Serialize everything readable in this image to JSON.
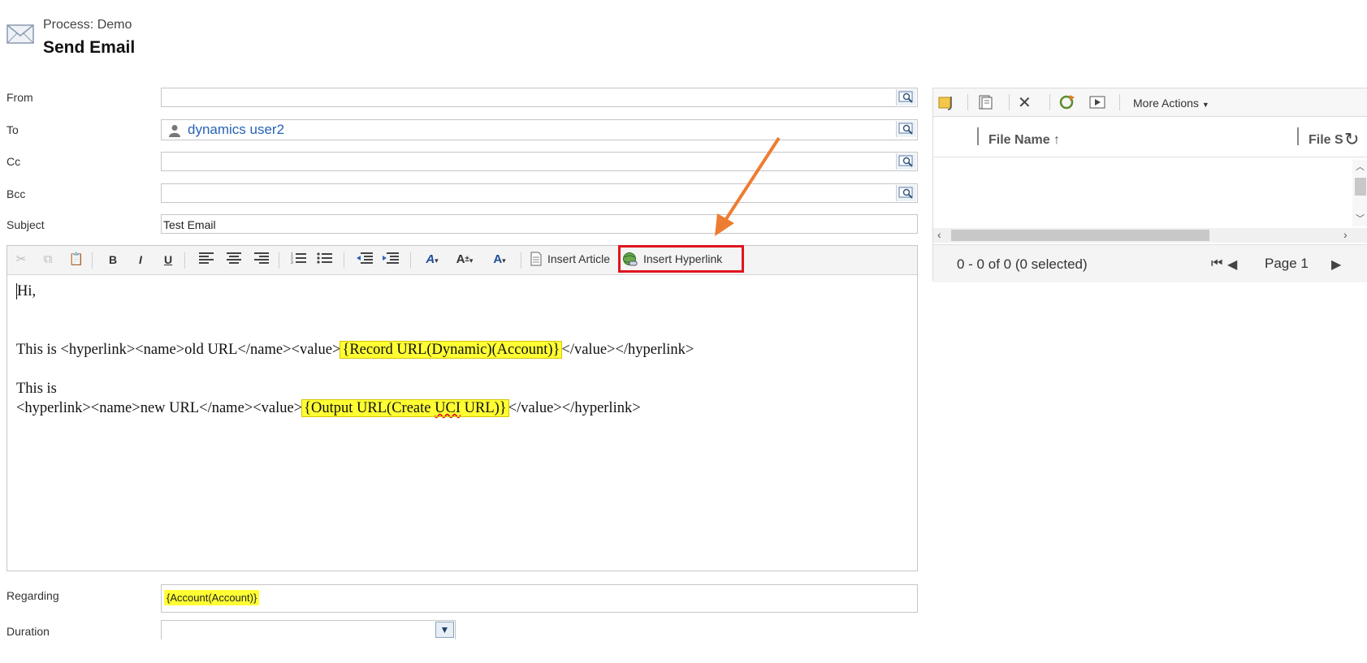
{
  "header": {
    "process_label": "Process: Demo",
    "title": "Send Email"
  },
  "form": {
    "from_label": "From",
    "to_label": "To",
    "to_value": "dynamics user2",
    "cc_label": "Cc",
    "bcc_label": "Bcc",
    "subject_label": "Subject",
    "subject_value": "Test Email",
    "regarding_label": "Regarding",
    "regarding_value": "{Account(Account)}",
    "duration_label": "Duration"
  },
  "editor": {
    "insert_article": "Insert Article",
    "insert_hyperlink": "Insert Hyperlink",
    "line1": "Hi,",
    "line2_prefix": "This is  <hyperlink><name>old URL</name><value>",
    "line2_mark": "{Record URL(Dynamic)(Account)}",
    "line2_suffix": "</value></hyperlink>",
    "line3": "This is",
    "line4_prefix": "<hyperlink><name>new URL</name><value>",
    "line4_mark_a": "{Output URL(Create ",
    "line4_mark_uci": "UCI",
    "line4_mark_b": " URL)}",
    "line4_suffix": "</value></hyperlink>"
  },
  "attachments": {
    "more_actions": "More Actions",
    "col_file_name": "File Name",
    "col_file_size": "File S",
    "count_text": "0 - 0 of 0 (0 selected)",
    "page_text": "Page 1"
  },
  "colors": {
    "highlight": "#ffff33",
    "callout_box": "#e0141e",
    "arrow": "#ed7d31",
    "link": "#2763b6"
  }
}
